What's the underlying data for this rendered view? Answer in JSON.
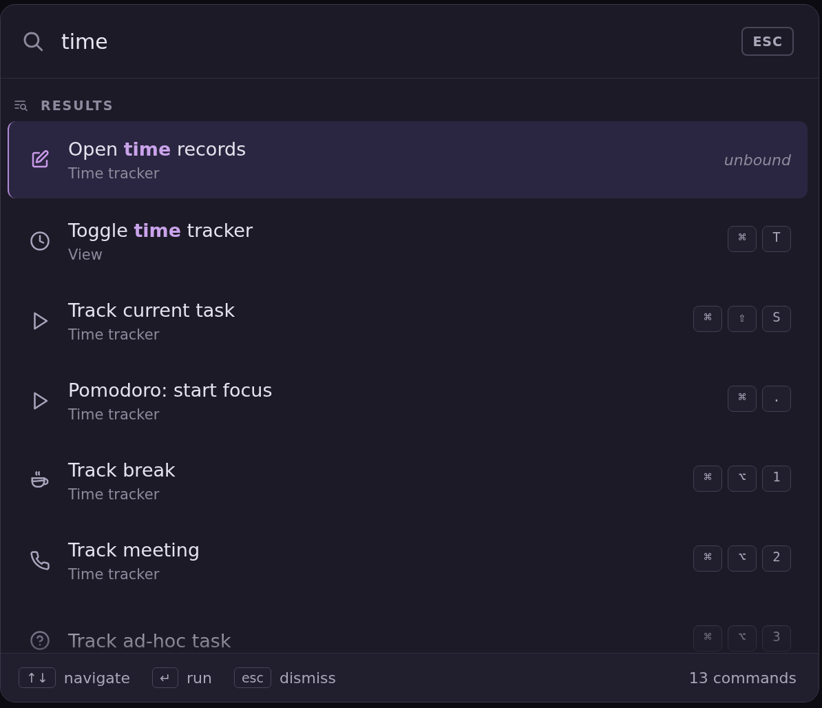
{
  "search": {
    "value": "time",
    "esc_key": "ESC"
  },
  "section": {
    "label": "RESULTS"
  },
  "results": [
    {
      "title": "Open **time** records",
      "subtitle": "Time tracker",
      "selected": true,
      "hint": "unbound"
    },
    {
      "title": "Toggle **time** tracker",
      "subtitle": "View",
      "selected": false,
      "keys": [
        "⌘",
        "T"
      ]
    },
    {
      "title": "Track current task",
      "subtitle": "Time tracker",
      "selected": false,
      "keys": [
        "⌘",
        "⇧",
        "S"
      ]
    },
    {
      "title": "Pomodoro: start focus",
      "subtitle": "Time tracker",
      "selected": false,
      "keys": [
        "⌘",
        "."
      ]
    },
    {
      "title": "Track break",
      "subtitle": "Time tracker",
      "selected": false,
      "keys": [
        "⌘",
        "⌥",
        "1"
      ]
    },
    {
      "title": "Track meeting",
      "subtitle": "Time tracker",
      "selected": false,
      "keys": [
        "⌘",
        "⌥",
        "2"
      ]
    },
    {
      "title": "Track ad-hoc task",
      "selected": false,
      "keys": [
        "⌘",
        "⌥",
        "3"
      ]
    }
  ],
  "footer": {
    "hints": [
      {
        "key": "↑↓",
        "label": "navigate"
      },
      {
        "key": "↵",
        "label": "run"
      },
      {
        "key": "esc",
        "label": "dismiss"
      }
    ],
    "count": "13 commands"
  }
}
